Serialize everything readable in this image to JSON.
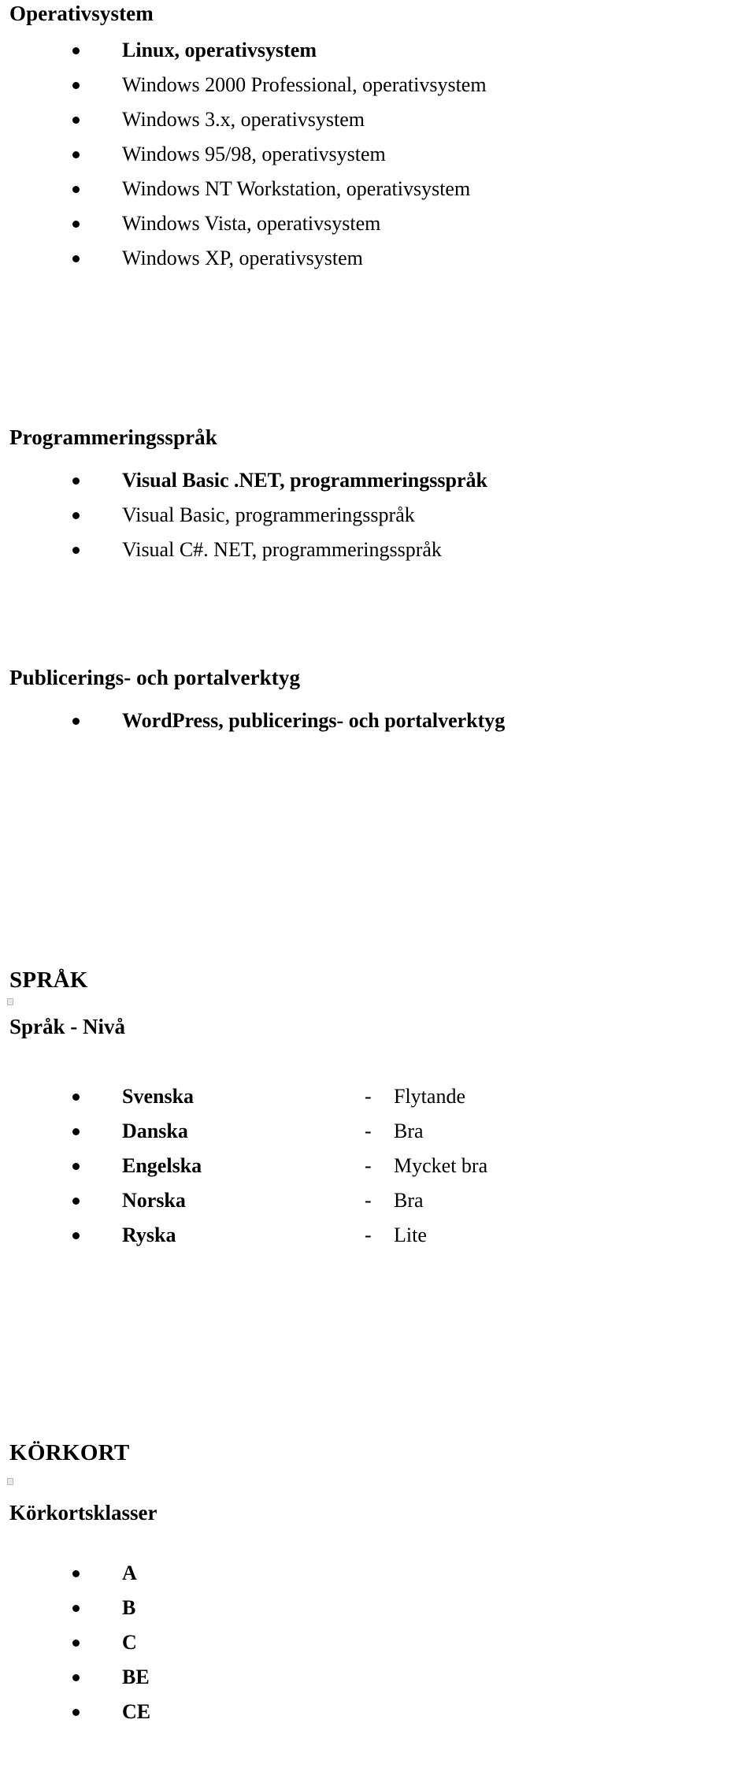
{
  "document": {
    "language": "sv",
    "background_color": "#ffffff",
    "text_color": "#000000"
  },
  "sections": {
    "operativsystem": {
      "heading": "Operativsystem",
      "items": [
        {
          "text": "Linux, operativsystem",
          "bold": true
        },
        {
          "text": "Windows 2000 Professional, operativsystem",
          "bold": false
        },
        {
          "text": "Windows 3.x, operativsystem",
          "bold": false
        },
        {
          "text": "Windows 95/98, operativsystem",
          "bold": false
        },
        {
          "text": "Windows NT Workstation, operativsystem",
          "bold": false
        },
        {
          "text": "Windows Vista, operativsystem",
          "bold": false
        },
        {
          "text": "Windows XP, operativsystem",
          "bold": false
        }
      ]
    },
    "programmeringssprak": {
      "heading": "Programmeringsspråk",
      "items": [
        {
          "text": "Visual Basic .NET, programmeringsspråk",
          "bold": true
        },
        {
          "text": "Visual Basic, programmeringsspråk",
          "bold": false
        },
        {
          "text": "Visual C#. NET, programmeringsspråk",
          "bold": false
        }
      ]
    },
    "publiceringsverktyg": {
      "heading": "Publicerings- och portalverktyg",
      "items": [
        {
          "text": "WordPress, publicerings- och portalverktyg",
          "bold": true
        }
      ]
    },
    "sprak": {
      "heading": "SPRÅK",
      "subheading": "Språk - Nivå",
      "separator": "-",
      "rows": [
        {
          "language": "Svenska",
          "level": "Flytande"
        },
        {
          "language": "Danska",
          "level": "Bra"
        },
        {
          "language": "Engelska",
          "level": "Mycket bra"
        },
        {
          "language": "Norska",
          "level": "Bra"
        },
        {
          "language": "Ryska",
          "level": "Lite"
        }
      ]
    },
    "korkort": {
      "heading": "KÖRKORT",
      "subheading": "Körkortsklasser",
      "classes": [
        {
          "text": "A"
        },
        {
          "text": "B"
        },
        {
          "text": "C"
        },
        {
          "text": "BE"
        },
        {
          "text": "CE"
        }
      ]
    }
  }
}
